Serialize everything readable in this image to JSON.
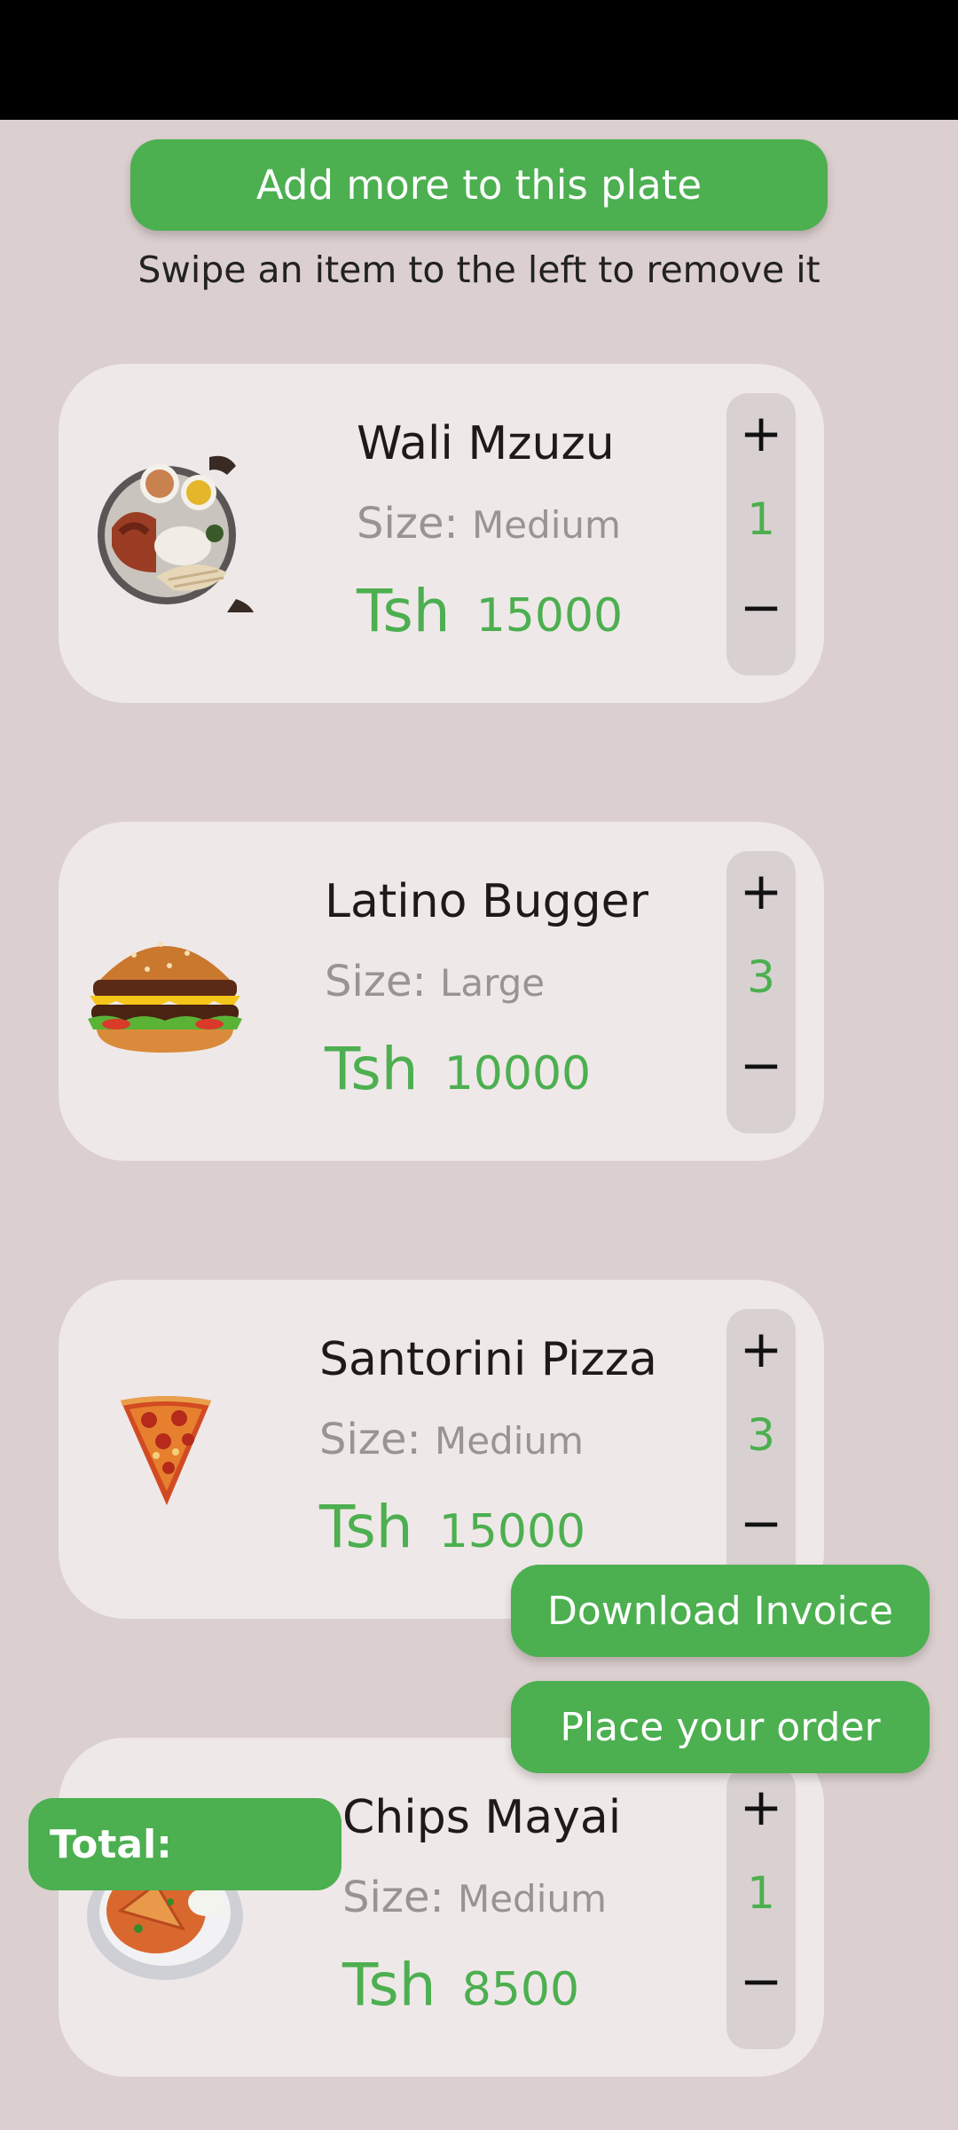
{
  "add_more_label": "Add more to this plate",
  "hint": "Swipe an item to the left to remove it",
  "currency": "Tsh",
  "size_label": "Size:",
  "items": [
    {
      "name": "Wali Mzuzu",
      "size": "Medium",
      "price": "15000",
      "qty": "1",
      "image_icon": "rice-plate-icon"
    },
    {
      "name": "Latino Bugger",
      "size": "Large",
      "price": "10000",
      "qty": "3",
      "image_icon": "burger-icon"
    },
    {
      "name": "Santorini Pizza",
      "size": "Medium",
      "price": "15000",
      "qty": "3",
      "image_icon": "pizza-slice-icon"
    },
    {
      "name": "Chips Mayai",
      "size": "Medium",
      "price": "8500",
      "qty": "1",
      "image_icon": "chips-omelette-icon"
    }
  ],
  "qty_plus": "+",
  "qty_minus": "−",
  "download_invoice_label": "Download Invoice",
  "place_order_label": "Place your order",
  "total_label": "Total:",
  "colors": {
    "accent": "#4caf50",
    "background": "#dccfcf",
    "card": "#efe8e8"
  }
}
